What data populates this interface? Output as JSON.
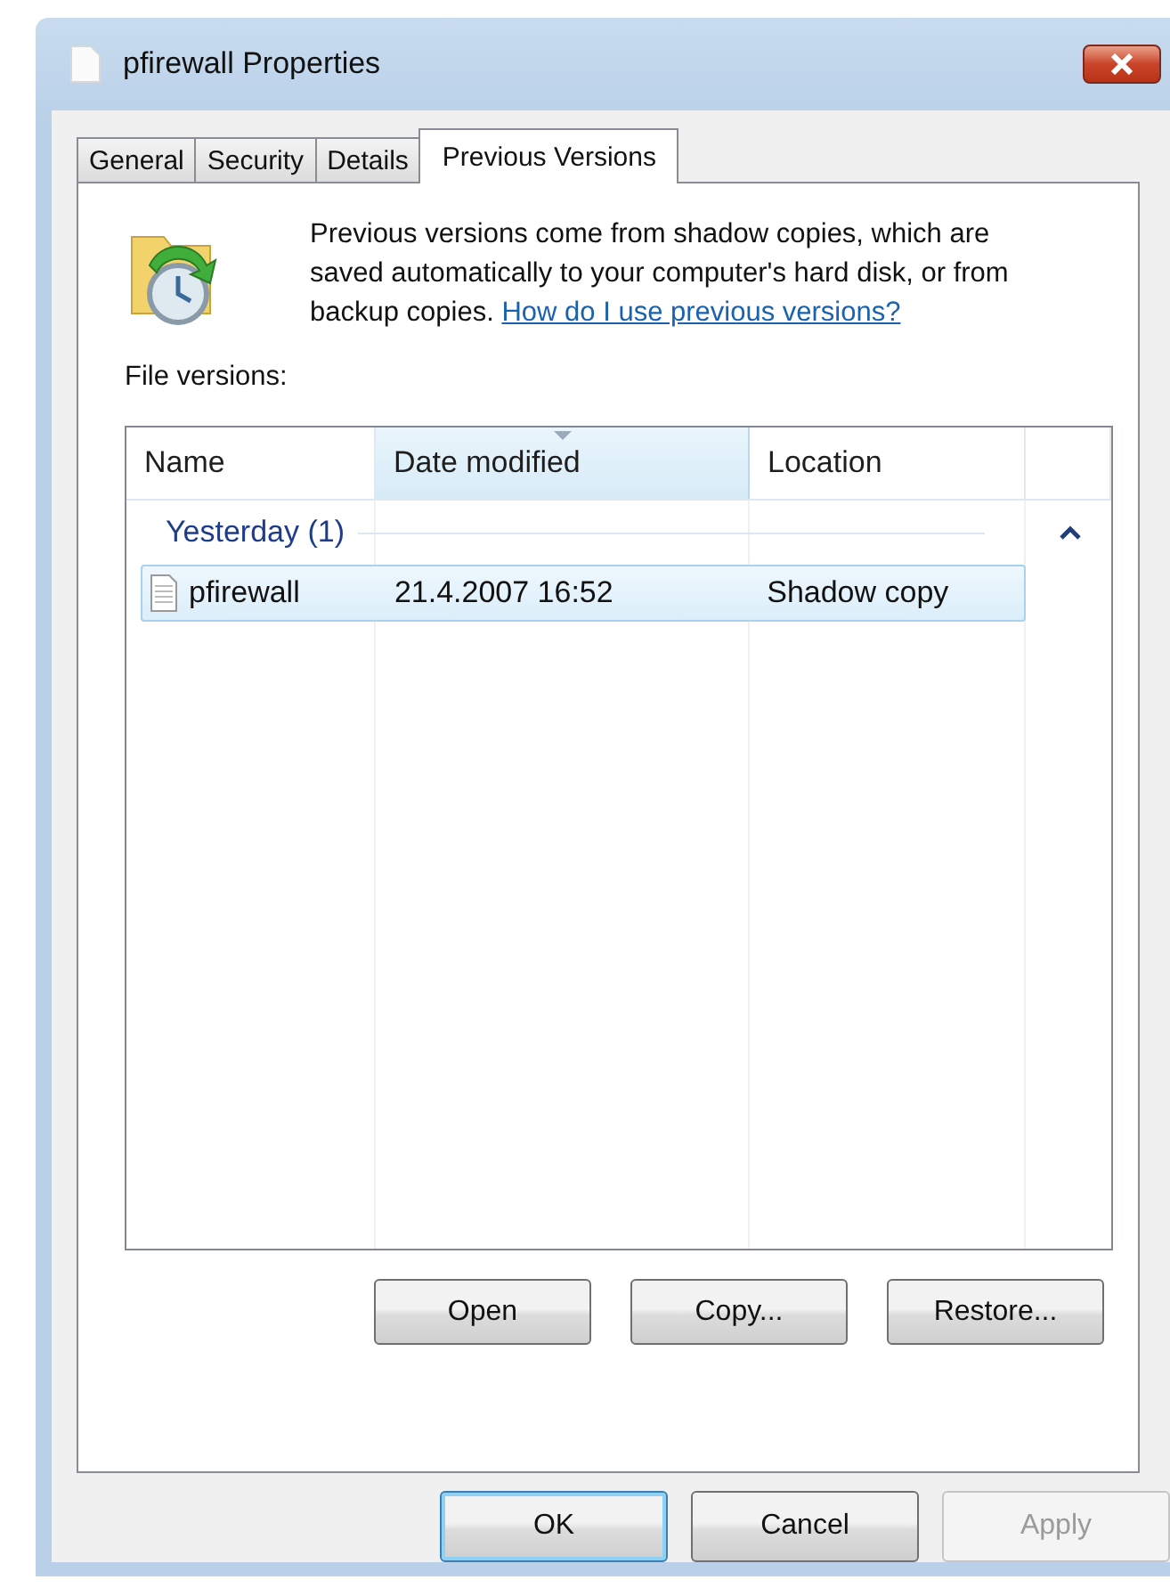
{
  "window": {
    "title": "pfirewall Properties"
  },
  "tabs": [
    {
      "label": "General",
      "selected": false
    },
    {
      "label": "Security",
      "selected": false
    },
    {
      "label": "Details",
      "selected": false
    },
    {
      "label": "Previous Versions",
      "selected": true
    }
  ],
  "description": {
    "text": "Previous versions come from shadow copies, which are saved automatically to your computer's hard disk, or from backup copies.",
    "link": "How do I use previous versions?"
  },
  "file_versions_label": "File versions:",
  "table": {
    "columns": [
      {
        "label": "Name",
        "sorted": false
      },
      {
        "label": "Date modified",
        "sorted": true
      },
      {
        "label": "Location",
        "sorted": false
      }
    ],
    "groups": [
      {
        "label": "Yesterday (1)",
        "expanded": true,
        "rows": [
          {
            "name": "pfirewall",
            "date": "21.4.2007 16:52",
            "location": "Shadow copy",
            "selected": true
          }
        ]
      }
    ]
  },
  "panel_buttons": [
    {
      "label": "Open",
      "disabled": false
    },
    {
      "label": "Copy...",
      "disabled": false
    },
    {
      "label": "Restore...",
      "disabled": false
    }
  ],
  "dialog_buttons": [
    {
      "label": "OK",
      "default": true,
      "disabled": false
    },
    {
      "label": "Cancel",
      "default": false,
      "disabled": false
    },
    {
      "label": "Apply",
      "default": false,
      "disabled": true
    }
  ]
}
